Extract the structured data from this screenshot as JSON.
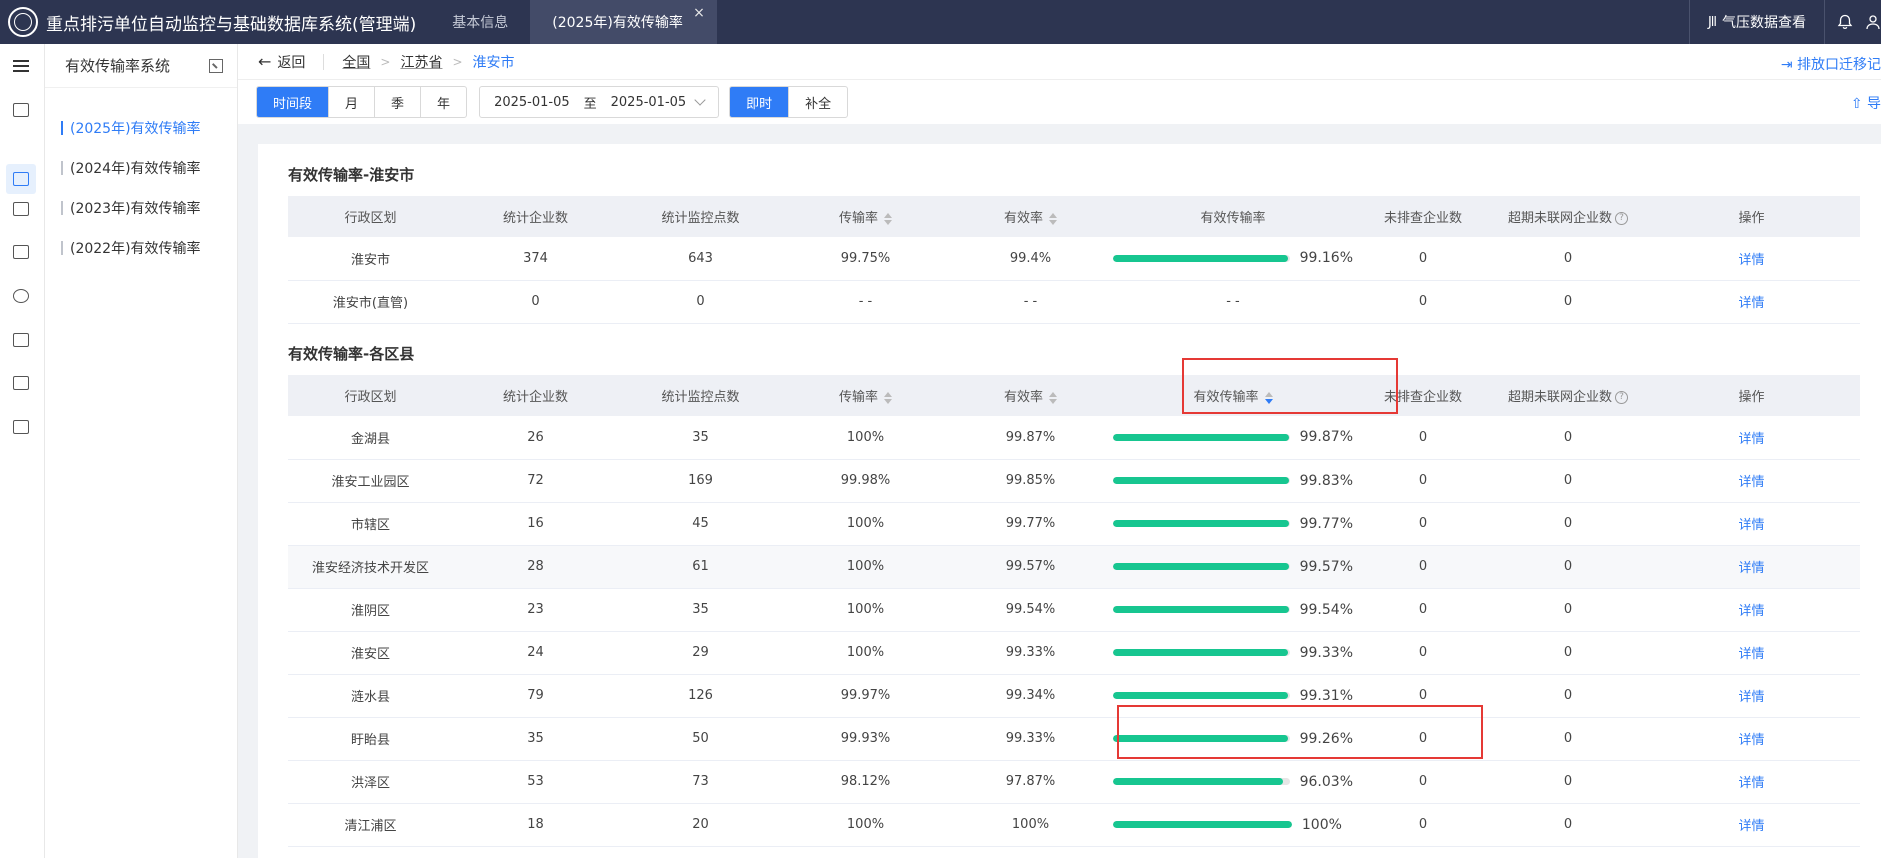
{
  "header": {
    "app_title": "重点排污单位自动监控与基础数据库系统(管理端)",
    "tabs": [
      {
        "label": "基本信息"
      },
      {
        "label": "(2025年)有效传输率",
        "close": "×"
      }
    ],
    "weather_icon_text": "Jll",
    "weather_label": "气压数据查看"
  },
  "subnav": {
    "title": "有效传输率系统",
    "items": [
      {
        "label": "(2025年)有效传输率"
      },
      {
        "label": "(2024年)有效传输率"
      },
      {
        "label": "(2023年)有效传输率"
      },
      {
        "label": "(2022年)有效传输率"
      }
    ]
  },
  "crumbs": {
    "back": "返回",
    "items": [
      "全国",
      "江苏省",
      "淮安市"
    ],
    "move_link": "排放口迁移记"
  },
  "filters": {
    "period": [
      "时间段",
      "月",
      "季",
      "年"
    ],
    "date_start": "2025-01-05",
    "date_sep": "至",
    "date_end": "2025-01-05",
    "mode": [
      "即时",
      "补全"
    ],
    "export": "导"
  },
  "table_headers": {
    "region": "行政区划",
    "companies": "统计企业数",
    "points": "统计监控点数",
    "trans_rate": "传输率",
    "valid_rate": "有效率",
    "eff_trans_rate": "有效传输率",
    "unchecked": "未排查企业数",
    "offline": "超期未联网企业数",
    "help": "?",
    "op": "操作"
  },
  "city_section": {
    "title": "有效传输率-淮安市",
    "rows": [
      {
        "region": "淮安市",
        "companies": "374",
        "points": "643",
        "trans": "99.75%",
        "valid": "99.4%",
        "eff": "99.16%",
        "eff_value": 99.16,
        "unchecked": "0",
        "offline": "0",
        "op": "详情"
      },
      {
        "region": "淮安市(直管)",
        "companies": "0",
        "points": "0",
        "trans": "- -",
        "valid": "- -",
        "eff": "- -",
        "unchecked": "0",
        "offline": "0",
        "op": "详情"
      }
    ]
  },
  "county_section": {
    "title": "有效传输率-各区县",
    "rows": [
      {
        "region": "金湖县",
        "companies": "26",
        "points": "35",
        "trans": "100%",
        "valid": "99.87%",
        "eff": "99.87%",
        "eff_value": 99.87,
        "unchecked": "0",
        "offline": "0",
        "op": "详情"
      },
      {
        "region": "淮安工业园区",
        "companies": "72",
        "points": "169",
        "trans": "99.98%",
        "valid": "99.85%",
        "eff": "99.83%",
        "eff_value": 99.83,
        "unchecked": "0",
        "offline": "0",
        "op": "详情"
      },
      {
        "region": "市辖区",
        "companies": "16",
        "points": "45",
        "trans": "100%",
        "valid": "99.77%",
        "eff": "99.77%",
        "eff_value": 99.77,
        "unchecked": "0",
        "offline": "0",
        "op": "详情"
      },
      {
        "region": "淮安经济技术开发区",
        "companies": "28",
        "points": "61",
        "trans": "100%",
        "valid": "99.57%",
        "eff": "99.57%",
        "eff_value": 99.57,
        "unchecked": "0",
        "offline": "0",
        "op": "详情"
      },
      {
        "region": "淮阴区",
        "companies": "23",
        "points": "35",
        "trans": "100%",
        "valid": "99.54%",
        "eff": "99.54%",
        "eff_value": 99.54,
        "unchecked": "0",
        "offline": "0",
        "op": "详情"
      },
      {
        "region": "淮安区",
        "companies": "24",
        "points": "29",
        "trans": "100%",
        "valid": "99.33%",
        "eff": "99.33%",
        "eff_value": 99.33,
        "unchecked": "0",
        "offline": "0",
        "op": "详情"
      },
      {
        "region": "涟水县",
        "companies": "79",
        "points": "126",
        "trans": "99.97%",
        "valid": "99.34%",
        "eff": "99.31%",
        "eff_value": 99.31,
        "unchecked": "0",
        "offline": "0",
        "op": "详情"
      },
      {
        "region": "盱眙县",
        "companies": "35",
        "points": "50",
        "trans": "99.93%",
        "valid": "99.33%",
        "eff": "99.26%",
        "eff_value": 99.26,
        "unchecked": "0",
        "offline": "0",
        "op": "详情"
      },
      {
        "region": "洪泽区",
        "companies": "53",
        "points": "73",
        "trans": "98.12%",
        "valid": "97.87%",
        "eff": "96.03%",
        "eff_value": 96.03,
        "unchecked": "0",
        "offline": "0",
        "op": "详情"
      },
      {
        "region": "清江浦区",
        "companies": "18",
        "points": "20",
        "trans": "100%",
        "valid": "100%",
        "eff": "100%",
        "eff_value": 100,
        "unchecked": "0",
        "offline": "0",
        "op": "详情"
      }
    ]
  },
  "colors": {
    "accent": "#2f7cf6",
    "bar": "#17c690",
    "header_bg": "#2d3551",
    "highlight": "#e53935"
  }
}
